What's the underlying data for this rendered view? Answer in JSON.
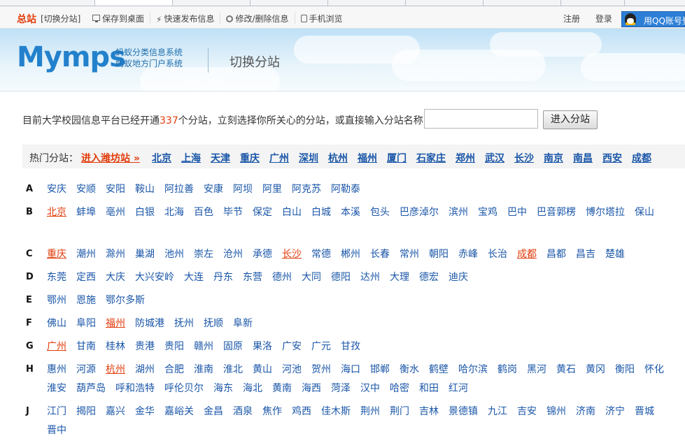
{
  "topbar": {
    "site": "总站",
    "switch": "[切换分站]",
    "links": [
      "保存到桌面",
      "快速发布信息",
      "修改/删除信息",
      "手机浏览"
    ],
    "register": "注册",
    "login": "登录",
    "qq_login": "用QQ账号登录"
  },
  "header": {
    "logo": "Mymps",
    "slogan_line1": "蚂蚁分类信息系统",
    "slogan_line2": "蚂蚁地方门户系统",
    "title": "切换分站"
  },
  "intro": {
    "before": "目前大学校园信息平台已经开通",
    "count": "337",
    "after": "个分站，立刻选择你所关心的分站，或直接输入分站名称"
  },
  "search": {
    "placeholder": "",
    "button": "进入分站"
  },
  "hot": {
    "label": "热门分站：",
    "enter": "进入潍坊站 »",
    "cities": [
      "北京",
      "上海",
      "天津",
      "重庆",
      "广州",
      "深圳",
      "杭州",
      "福州",
      "厦门",
      "石家庄",
      "郑州",
      "武汉",
      "长沙",
      "南京",
      "南昌",
      "西安",
      "成都"
    ]
  },
  "groups": [
    {
      "letter": "A",
      "cities": [
        "安庆",
        "安顺",
        "安阳",
        "鞍山",
        "阿拉善",
        "安康",
        "阿坝",
        "阿里",
        "阿克苏",
        "阿勒泰"
      ]
    },
    {
      "letter": "B",
      "cities": [
        "北京",
        "蚌埠",
        "亳州",
        "白银",
        "北海",
        "百色",
        "毕节",
        "保定",
        "白山",
        "白城",
        "本溪",
        "包头",
        "巴彦淖尔",
        "滨州",
        "宝鸡",
        "巴中",
        "巴音郭楞",
        "博尔塔拉",
        "保山"
      ]
    },
    {
      "letter": "C",
      "cities": [
        "重庆",
        "潮州",
        "滁州",
        "巢湖",
        "池州",
        "崇左",
        "沧州",
        "承德",
        "长沙",
        "常德",
        "郴州",
        "长春",
        "常州",
        "朝阳",
        "赤峰",
        "长治",
        "成都",
        "昌都",
        "昌吉",
        "楚雄"
      ]
    },
    {
      "letter": "D",
      "cities": [
        "东莞",
        "定西",
        "大庆",
        "大兴安岭",
        "大连",
        "丹东",
        "东营",
        "德州",
        "大同",
        "德阳",
        "达州",
        "大理",
        "德宏",
        "迪庆"
      ]
    },
    {
      "letter": "E",
      "cities": [
        "鄂州",
        "恩施",
        "鄂尔多斯"
      ]
    },
    {
      "letter": "F",
      "cities": [
        "佛山",
        "阜阳",
        "福州",
        "防城港",
        "抚州",
        "抚顺",
        "阜新"
      ]
    },
    {
      "letter": "G",
      "cities": [
        "广州",
        "甘南",
        "桂林",
        "贵港",
        "贵阳",
        "赣州",
        "固原",
        "果洛",
        "广安",
        "广元",
        "甘孜"
      ]
    },
    {
      "letter": "H",
      "cities": [
        "惠州",
        "河源",
        "杭州",
        "湖州",
        "合肥",
        "淮南",
        "淮北",
        "黄山",
        "河池",
        "贺州",
        "海口",
        "邯郸",
        "衡水",
        "鹤壁",
        "哈尔滨",
        "鹤岗",
        "黑河",
        "黄石",
        "黄冈",
        "衡阳",
        "怀化",
        "淮安",
        "葫芦岛",
        "呼和浩特",
        "呼伦贝尔",
        "海东",
        "海北",
        "黄南",
        "海西",
        "菏泽",
        "汉中",
        "哈密",
        "和田",
        "红河"
      ]
    },
    {
      "letter": "J",
      "cities": [
        "江门",
        "揭阳",
        "嘉兴",
        "金华",
        "嘉峪关",
        "金昌",
        "酒泉",
        "焦作",
        "鸡西",
        "佳木斯",
        "荆州",
        "荆门",
        "吉林",
        "景德镇",
        "九江",
        "吉安",
        "锦州",
        "济南",
        "济宁",
        "晋城",
        "晋中"
      ]
    }
  ],
  "highlighted": [
    "北京",
    "重庆",
    "长沙",
    "成都",
    "福州",
    "广州",
    "杭州"
  ]
}
